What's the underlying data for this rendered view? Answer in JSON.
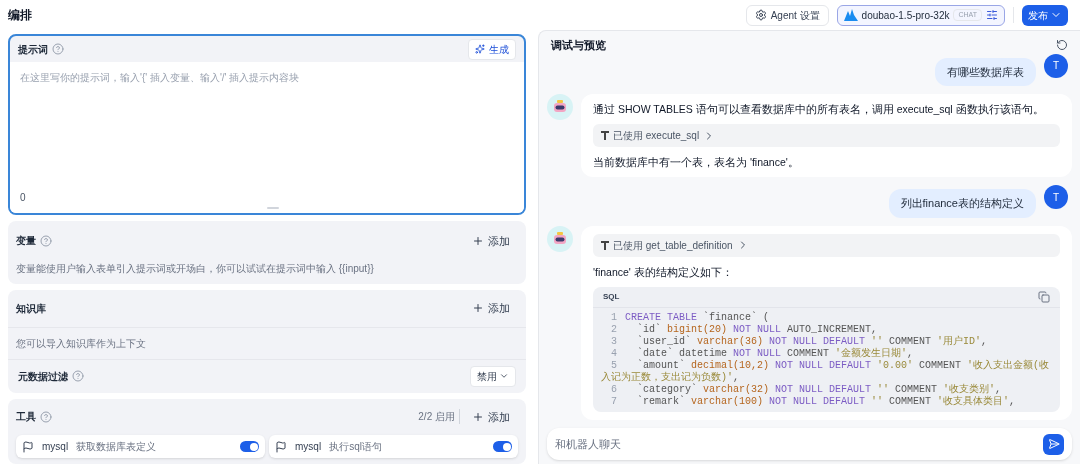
{
  "page_title": "编排",
  "header": {
    "agent_settings": "Agent 设置",
    "model": {
      "name": "doubao-1.5-pro-32k",
      "tag": "CHAT"
    },
    "publish": "发布"
  },
  "prompt": {
    "title": "提示词",
    "generate": "生成",
    "placeholder": "在这里写你的提示词，输入'{' 插入变量、输入'/' 插入提示内容块",
    "count": "0"
  },
  "variables": {
    "title": "变量",
    "add": "添加",
    "description": "变量能使用户输入表单引入提示词或开场白，你可以试试在提示词中输入 {{input}}"
  },
  "knowledge": {
    "title": "知识库",
    "add": "添加",
    "description": "您可以导入知识库作为上下文",
    "filter_label": "元数据过滤",
    "filter_value": "禁用"
  },
  "tools": {
    "title": "工具",
    "count": "2/2 启用",
    "add": "添加",
    "items": [
      {
        "provider": "mysql",
        "name": "获取数据库表定义",
        "on": true
      },
      {
        "provider": "mysql",
        "name": "执行sql语句",
        "on": true
      }
    ]
  },
  "preview": {
    "title": "调试与预览",
    "input_placeholder": "和机器人聊天",
    "messages": [
      {
        "kind": "user",
        "avatar": "T",
        "text": "有哪些数据库表"
      },
      {
        "kind": "bot",
        "blocks": [
          {
            "kind": "text",
            "text": "通过 SHOW TABLES 语句可以查看数据库中的所有表名，调用 execute_sql 函数执行该语句。"
          },
          {
            "kind": "tool",
            "label": "已使用",
            "tool": "execute_sql"
          },
          {
            "kind": "text",
            "text": "当前数据库中有一个表，表名为 'finance'。"
          }
        ]
      },
      {
        "kind": "user",
        "avatar": "T",
        "text": "列出finance表的结构定义"
      },
      {
        "kind": "bot",
        "blocks": [
          {
            "kind": "tool",
            "label": "已使用",
            "tool": "get_table_definition"
          },
          {
            "kind": "text",
            "text": "'finance' 表的结构定义如下："
          },
          {
            "kind": "code",
            "language": "SQL",
            "lines": [
              {
                "number": "1",
                "segments": [
                  {
                    "kind": "keyword",
                    "text": "CREATE TABLE"
                  },
                  {
                    "kind": "plain",
                    "text": " `finance` ("
                  }
                ]
              },
              {
                "number": "2",
                "segments": [
                  {
                    "kind": "plain",
                    "text": "  `id` "
                  },
                  {
                    "kind": "type",
                    "text": "bigint(20)"
                  },
                  {
                    "kind": "keyword",
                    "text": " NOT NULL"
                  },
                  {
                    "kind": "plain",
                    "text": " AUTO_INCREMENT,"
                  }
                ]
              },
              {
                "number": "3",
                "segments": [
                  {
                    "kind": "plain",
                    "text": "  `user_id` "
                  },
                  {
                    "kind": "type",
                    "text": "varchar(36)"
                  },
                  {
                    "kind": "keyword",
                    "text": " NOT NULL DEFAULT"
                  },
                  {
                    "kind": "string",
                    "text": " ''"
                  },
                  {
                    "kind": "plain",
                    "text": " COMMENT "
                  },
                  {
                    "kind": "string",
                    "text": "'用户ID'"
                  },
                  {
                    "kind": "plain",
                    "text": ","
                  }
                ]
              },
              {
                "number": "4",
                "segments": [
                  {
                    "kind": "plain",
                    "text": "  `date` datetime "
                  },
                  {
                    "kind": "keyword",
                    "text": "NOT NULL"
                  },
                  {
                    "kind": "plain",
                    "text": " COMMENT "
                  },
                  {
                    "kind": "string",
                    "text": "'金额发生日期'"
                  },
                  {
                    "kind": "plain",
                    "text": ","
                  }
                ]
              },
              {
                "number": "5",
                "segments": [
                  {
                    "kind": "plain",
                    "text": "  `amount` "
                  },
                  {
                    "kind": "type",
                    "text": "decimal(10,2)"
                  },
                  {
                    "kind": "keyword",
                    "text": " NOT NULL DEFAULT"
                  },
                  {
                    "kind": "string",
                    "text": " '0.00'"
                  },
                  {
                    "kind": "plain",
                    "text": " COMMENT "
                  },
                  {
                    "kind": "string",
                    "text": "'收入支出金额(收入记为正数，支出记为负数)'"
                  },
                  {
                    "kind": "plain",
                    "text": ","
                  }
                ]
              },
              {
                "number": "6",
                "segments": [
                  {
                    "kind": "plain",
                    "text": "  `category` "
                  },
                  {
                    "kind": "type",
                    "text": "varchar(32)"
                  },
                  {
                    "kind": "keyword",
                    "text": " NOT NULL DEFAULT"
                  },
                  {
                    "kind": "string",
                    "text": " ''"
                  },
                  {
                    "kind": "plain",
                    "text": " COMMENT "
                  },
                  {
                    "kind": "string",
                    "text": "'收支类别'"
                  },
                  {
                    "kind": "plain",
                    "text": ","
                  }
                ]
              },
              {
                "number": "7",
                "segments": [
                  {
                    "kind": "plain",
                    "text": "  `remark` "
                  },
                  {
                    "kind": "type",
                    "text": "varchar(100)"
                  },
                  {
                    "kind": "keyword",
                    "text": " NOT NULL DEFAULT"
                  },
                  {
                    "kind": "string",
                    "text": " ''"
                  },
                  {
                    "kind": "plain",
                    "text": " COMMENT "
                  },
                  {
                    "kind": "string",
                    "text": "'收支具体类目'"
                  },
                  {
                    "kind": "plain",
                    "text": ","
                  }
                ]
              }
            ]
          }
        ]
      }
    ]
  }
}
